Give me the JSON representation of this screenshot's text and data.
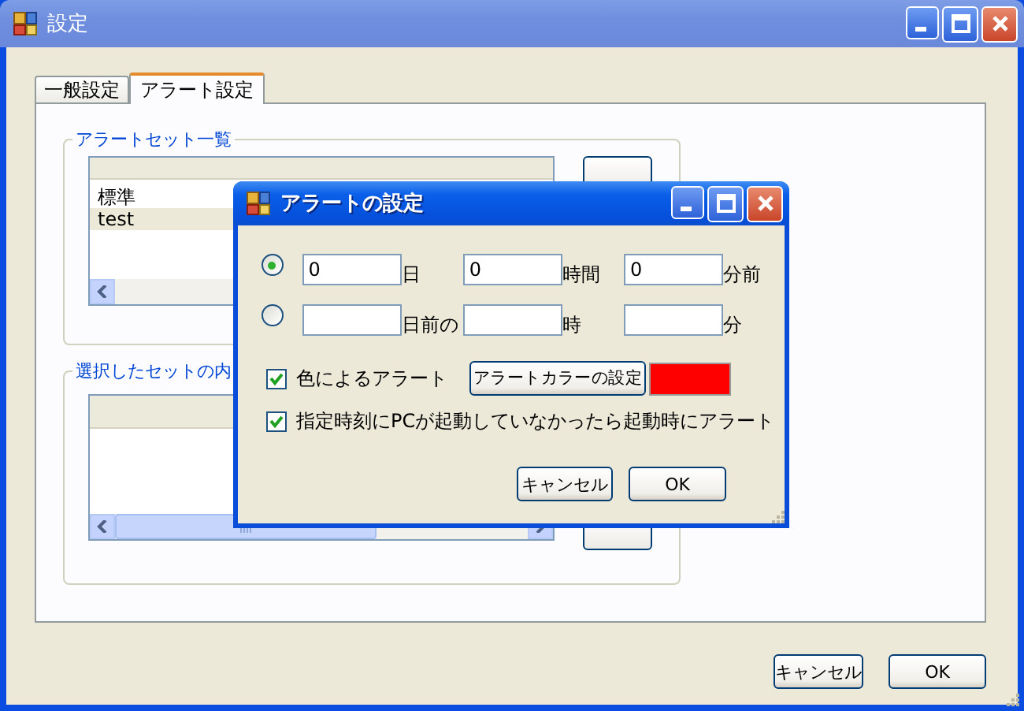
{
  "window": {
    "title": "設定"
  },
  "tabs": [
    {
      "label": "一般設定",
      "selected": false
    },
    {
      "label": "アラート設定",
      "selected": true
    }
  ],
  "alert_sets": {
    "title": "アラートセット一覧",
    "items": [
      {
        "text": "標準",
        "selected": false
      },
      {
        "text": "test",
        "selected": true
      }
    ]
  },
  "set_contents": {
    "title": "選択したセットの内"
  },
  "buttons": [
    "キャンセル",
    "OK"
  ],
  "dialog": {
    "title": "アラートの設定",
    "timing_options": [
      {
        "selected": true,
        "fields": [
          {
            "value": "0",
            "unit": "日"
          },
          {
            "value": "0",
            "unit": "時間"
          },
          {
            "value": "0",
            "unit": "分前"
          }
        ]
      },
      {
        "selected": false,
        "fields": [
          {
            "unit": "日前の"
          },
          {
            "unit": "時"
          },
          {
            "unit": "分"
          }
        ]
      }
    ],
    "color_alert": {
      "label": "色によるアラート",
      "checked": true
    },
    "color_button": "アラートカラーの設定",
    "color_swatch": {
      "color": "#ff0000"
    },
    "startup_alert": {
      "label": "指定時刻にPCが起動していなかったら起動時にアラート",
      "checked": true
    },
    "buttons": [
      "キャンセル",
      "OK"
    ]
  }
}
